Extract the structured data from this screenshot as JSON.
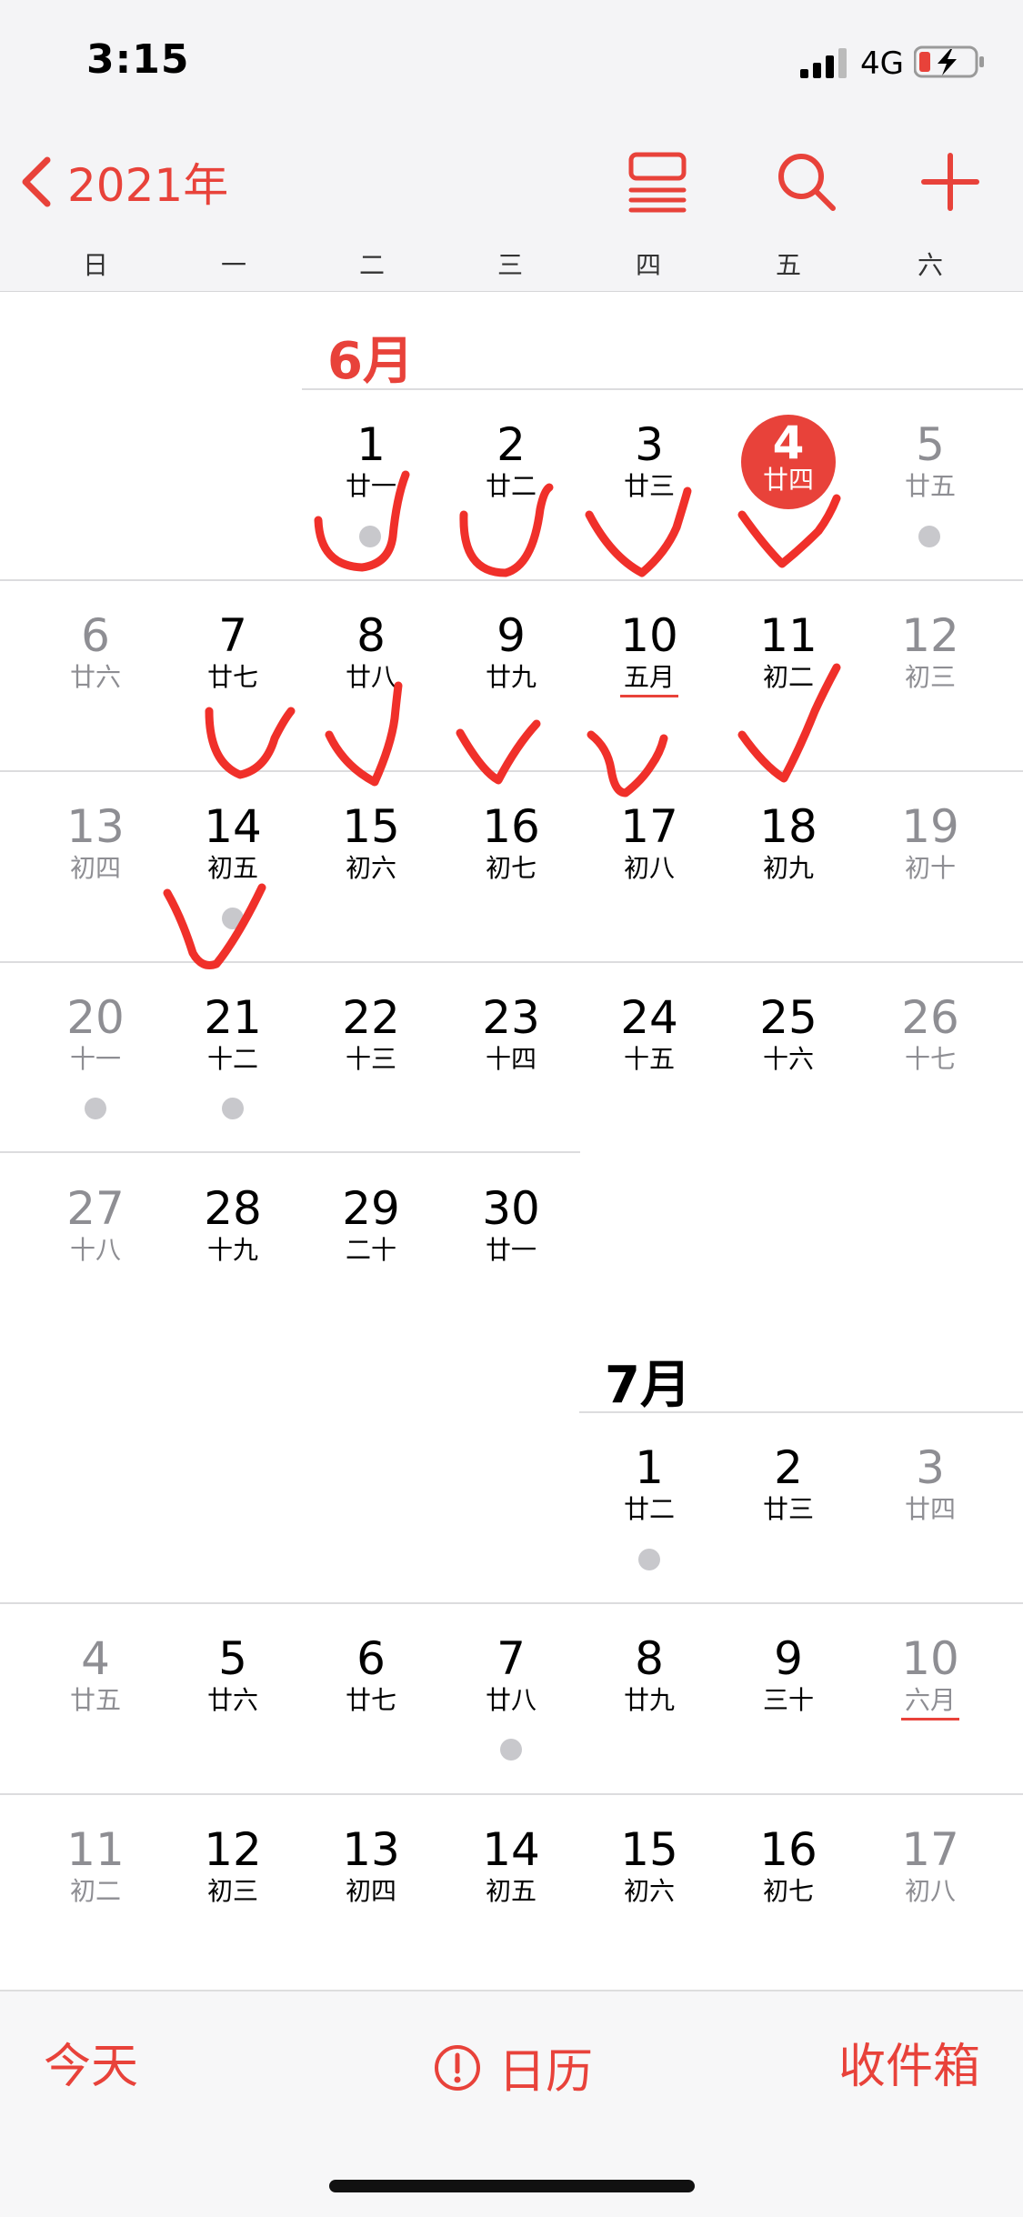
{
  "status_bar": {
    "time": "3:15",
    "network": "4G"
  },
  "nav": {
    "back_label": "2021年"
  },
  "weekdays": [
    "日",
    "一",
    "二",
    "三",
    "四",
    "五",
    "六"
  ],
  "accent_color": "#e8423a",
  "months": {
    "june": {
      "title": "6月",
      "days": [
        {
          "day": "1",
          "lunar": "廿一"
        },
        {
          "day": "2",
          "lunar": "廿二"
        },
        {
          "day": "3",
          "lunar": "廿三"
        },
        {
          "day": "4",
          "lunar": "廿四"
        },
        {
          "day": "5",
          "lunar": "廿五"
        },
        {
          "day": "6",
          "lunar": "廿六"
        },
        {
          "day": "7",
          "lunar": "廿七"
        },
        {
          "day": "8",
          "lunar": "廿八"
        },
        {
          "day": "9",
          "lunar": "廿九"
        },
        {
          "day": "10",
          "lunar": "五月"
        },
        {
          "day": "11",
          "lunar": "初二"
        },
        {
          "day": "12",
          "lunar": "初三"
        },
        {
          "day": "13",
          "lunar": "初四"
        },
        {
          "day": "14",
          "lunar": "初五"
        },
        {
          "day": "15",
          "lunar": "初六"
        },
        {
          "day": "16",
          "lunar": "初七"
        },
        {
          "day": "17",
          "lunar": "初八"
        },
        {
          "day": "18",
          "lunar": "初九"
        },
        {
          "day": "19",
          "lunar": "初十"
        },
        {
          "day": "20",
          "lunar": "十一"
        },
        {
          "day": "21",
          "lunar": "十二"
        },
        {
          "day": "22",
          "lunar": "十三"
        },
        {
          "day": "23",
          "lunar": "十四"
        },
        {
          "day": "24",
          "lunar": "十五"
        },
        {
          "day": "25",
          "lunar": "十六"
        },
        {
          "day": "26",
          "lunar": "十七"
        },
        {
          "day": "27",
          "lunar": "十八"
        },
        {
          "day": "28",
          "lunar": "十九"
        },
        {
          "day": "29",
          "lunar": "二十"
        },
        {
          "day": "30",
          "lunar": "廿一"
        }
      ]
    },
    "july": {
      "title": "7月",
      "days": [
        {
          "day": "1",
          "lunar": "廿二"
        },
        {
          "day": "2",
          "lunar": "廿三"
        },
        {
          "day": "3",
          "lunar": "廿四"
        },
        {
          "day": "4",
          "lunar": "廿五"
        },
        {
          "day": "5",
          "lunar": "廿六"
        },
        {
          "day": "6",
          "lunar": "廿七"
        },
        {
          "day": "7",
          "lunar": "廿八"
        },
        {
          "day": "8",
          "lunar": "廿九"
        },
        {
          "day": "9",
          "lunar": "三十"
        },
        {
          "day": "10",
          "lunar": "六月"
        },
        {
          "day": "11",
          "lunar": "初二"
        },
        {
          "day": "12",
          "lunar": "初三"
        },
        {
          "day": "13",
          "lunar": "初四"
        },
        {
          "day": "14",
          "lunar": "初五"
        },
        {
          "day": "15",
          "lunar": "初六"
        },
        {
          "day": "16",
          "lunar": "初七"
        },
        {
          "day": "17",
          "lunar": "初八"
        }
      ]
    }
  },
  "tab_bar": {
    "today": "今天",
    "calendars": "日历",
    "inbox": "收件箱"
  }
}
